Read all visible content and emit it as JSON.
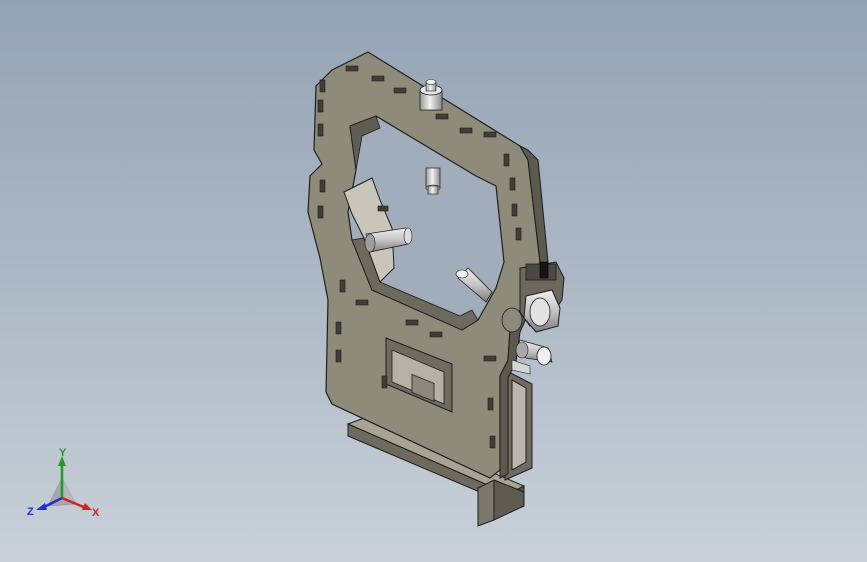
{
  "viewport": {
    "background_top": "#94a3b4",
    "background_bottom": "#c9d0d8"
  },
  "model": {
    "part_color": "#8e8a7a",
    "part_dark": "#5f5c52",
    "edge_color": "#1e1e1e",
    "metal_color": "#d9d9d9"
  },
  "triad": {
    "x_label": "X",
    "y_label": "Y",
    "z_label": "Z",
    "x_color": "#d42020",
    "y_color": "#1ea01e",
    "z_color": "#2030d0"
  }
}
